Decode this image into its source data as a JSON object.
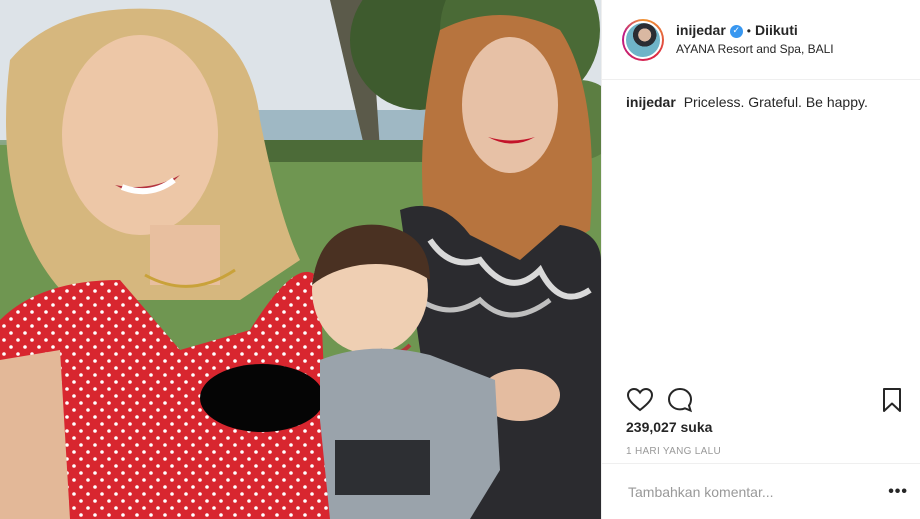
{
  "post": {
    "username": "inijedar",
    "verified_icon": "verified-badge-icon",
    "separator": "•",
    "follow_status": "Diikuti",
    "location": "AYANA Resort and Spa, BALI",
    "caption_user": "inijedar",
    "caption_text": "Priceless. Grateful. Be happy.",
    "likes": "239,027 suka",
    "timestamp": "1 HARI YANG LALU",
    "comment_placeholder": "Tambahkan komentar...",
    "more_label": "•••"
  },
  "icons": {
    "like": "heart-icon",
    "comment": "comment-bubble-icon",
    "save": "bookmark-icon",
    "more": "more-options-icon"
  },
  "colors": {
    "verified": "#3897f0",
    "text": "#262626",
    "muted": "#999999",
    "border": "#efefef"
  }
}
